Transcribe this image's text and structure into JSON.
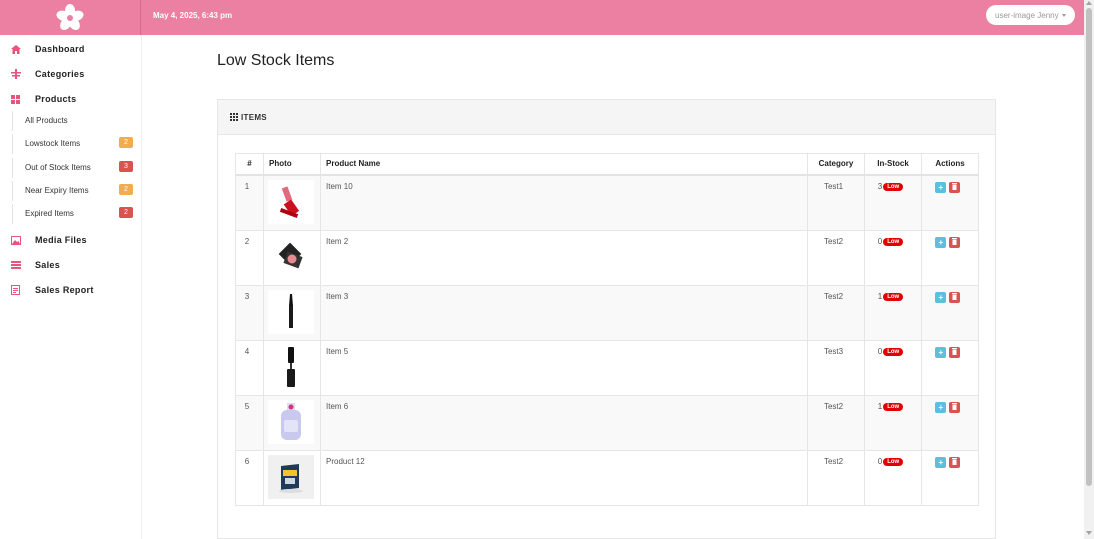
{
  "header": {
    "datetime": "May 4, 2025, 6:43 pm",
    "user_label": "user-image Jenny",
    "colors": {
      "topbar": "#eb80a2"
    }
  },
  "sidebar": {
    "items": [
      {
        "label": "Dashboard",
        "icon": "home-icon"
      },
      {
        "label": "Categories",
        "icon": "category-icon"
      },
      {
        "label": "Products",
        "icon": "grid-icon"
      },
      {
        "label": "Media Files",
        "icon": "image-icon"
      },
      {
        "label": "Sales",
        "icon": "list-icon"
      },
      {
        "label": "Sales Report",
        "icon": "report-icon"
      }
    ],
    "product_submenu": [
      {
        "label": "All Products",
        "badge": ""
      },
      {
        "label": "Lowstock Items",
        "badge": "2",
        "badge_color": "#f0ad4e"
      },
      {
        "label": "Out of Stock Items",
        "badge": "3",
        "badge_color": "#d9534f"
      },
      {
        "label": "Near Expiry Items",
        "badge": "2",
        "badge_color": "#f0ad4e"
      },
      {
        "label": "Expired Items",
        "badge": "2",
        "badge_color": "#d9534f"
      }
    ]
  },
  "main": {
    "title": "Low Stock Items",
    "panel_title": "ITEMS",
    "table": {
      "columns": [
        "#",
        "Photo",
        "Product Name",
        "Category",
        "In-Stock",
        "Actions"
      ],
      "low_label": "Low",
      "add_label": "+",
      "rows": [
        {
          "num": "1",
          "name": "Item 10",
          "category": "Test1",
          "stock": "3",
          "photo": "lipstick"
        },
        {
          "num": "2",
          "name": "Item 2",
          "category": "Test2",
          "stock": "0",
          "photo": "blush"
        },
        {
          "num": "3",
          "name": "Item 3",
          "category": "Test2",
          "stock": "1",
          "photo": "eyeliner"
        },
        {
          "num": "4",
          "name": "Item 5",
          "category": "Test3",
          "stock": "0",
          "photo": "mascara"
        },
        {
          "num": "5",
          "name": "Item 6",
          "category": "Test2",
          "stock": "1",
          "photo": "lotion"
        },
        {
          "num": "6",
          "name": "Product 12",
          "category": "Test2",
          "stock": "0",
          "photo": "sunscreen"
        }
      ]
    }
  }
}
